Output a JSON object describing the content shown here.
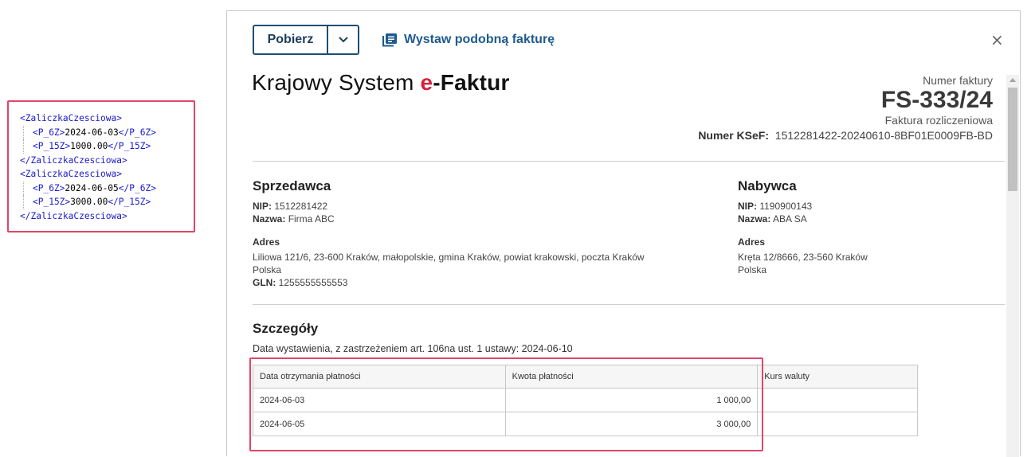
{
  "xml": {
    "lines": [
      {
        "open": "<ZaliczkaCzesciowa>",
        "value": "",
        "close": "",
        "indent": false
      },
      {
        "open": "<P_6Z>",
        "value": "2024-06-03",
        "close": "</P_6Z>",
        "indent": true
      },
      {
        "open": "<P_15Z>",
        "value": "1000.00",
        "close": "</P_15Z>",
        "indent": true
      },
      {
        "open": "</ZaliczkaCzesciowa>",
        "value": "",
        "close": "",
        "indent": false
      },
      {
        "open": "<ZaliczkaCzesciowa>",
        "value": "",
        "close": "",
        "indent": false
      },
      {
        "open": "<P_6Z>",
        "value": "2024-06-05",
        "close": "</P_6Z>",
        "indent": true
      },
      {
        "open": "<P_15Z>",
        "value": "3000.00",
        "close": "</P_15Z>",
        "indent": true
      },
      {
        "open": "</ZaliczkaCzesciowa>",
        "value": "",
        "close": "",
        "indent": false
      }
    ]
  },
  "toolbar": {
    "download_label": "Pobierz",
    "similar_invoice_label": "Wystaw podobną fakturę",
    "close_symbol": "×"
  },
  "logo": {
    "part1": "Krajowy System ",
    "part2": "e",
    "part3": "-Faktur"
  },
  "invoice": {
    "number_label": "Numer faktury",
    "number": "FS-333/24",
    "type": "Faktura rozliczeniowa",
    "ksef_label": "Numer KSeF:",
    "ksef_number": "1512281422-20240610-8BF01E0009FB-BD"
  },
  "seller": {
    "title": "Sprzedawca",
    "nip_label": "NIP:",
    "nip": "1512281422",
    "name_label": "Nazwa:",
    "name": "Firma ABC",
    "address_title": "Adres",
    "address_line1": "Liliowa 121/6, 23-600 Kraków, małopolskie, gmina Kraków, powiat krakowski, poczta Kraków",
    "address_line2": "Polska",
    "gln_label": "GLN:",
    "gln": "1255555555553"
  },
  "buyer": {
    "title": "Nabywca",
    "nip_label": "NIP:",
    "nip": "1190900143",
    "name_label": "Nazwa:",
    "name": "ABA SA",
    "address_title": "Adres",
    "address_line1": "Kręta 12/8666, 23-560 Kraków",
    "address_line2": "Polska"
  },
  "details": {
    "title": "Szczegóły",
    "issue_date_label": "Data wystawienia, z zastrzeżeniem art. 106na ust. 1 ustawy:",
    "issue_date": "2024-06-10"
  },
  "payments_table": {
    "headers": [
      "Data otrzymania płatności",
      "Kwota płatności",
      "Kurs waluty"
    ],
    "rows": [
      [
        "2024-06-03",
        "1 000,00",
        ""
      ],
      [
        "2024-06-05",
        "3 000,00",
        ""
      ]
    ]
  },
  "colors": {
    "highlight": "#e0456a",
    "primary": "#1d4e73",
    "link": "#1e5a8e",
    "logo_accent": "#d6213c"
  }
}
